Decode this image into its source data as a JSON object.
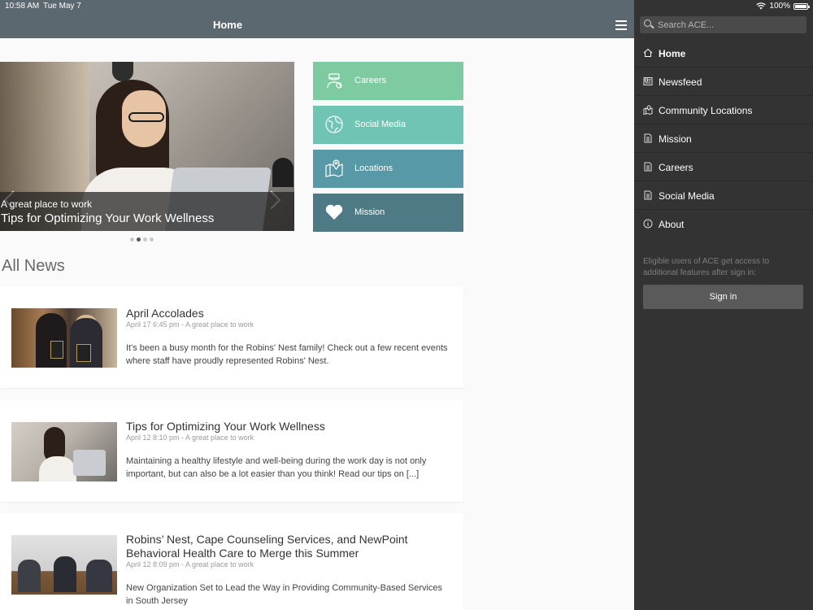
{
  "status": {
    "time": "10:58 AM",
    "date": "Tue May 7",
    "battery": "100%"
  },
  "header": {
    "title": "Home"
  },
  "carousel": {
    "category": "A great place to work",
    "headline": "Tips for Optimizing Your Work Wellness",
    "active_slide": 2,
    "slide_count": 4
  },
  "tiles": [
    {
      "label": "Careers",
      "icon": "careers-icon",
      "color": "#7ecba2"
    },
    {
      "label": "Social Media",
      "icon": "globe-icon",
      "color": "#6fc4b4"
    },
    {
      "label": "Locations",
      "icon": "map-pin-icon",
      "color": "#5799a6"
    },
    {
      "label": "Mission",
      "icon": "heart-icon",
      "color": "#4e7a86"
    }
  ],
  "news": {
    "heading": "All News",
    "items": [
      {
        "title": "April Accolades",
        "meta": "April 17 6:45 pm - A great place to work",
        "excerpt": "It's been a busy month for the Robins' Nest family! Check out a few recent events where staff have proudly represented Robins' Nest."
      },
      {
        "title": "Tips for Optimizing Your Work Wellness",
        "meta": "April 12 8:10 pm - A great place to work",
        "excerpt": "Maintaining a healthy lifestyle and well-being during the work day is not only important, but can also be a lot easier than you think! Read our tips on [...]"
      },
      {
        "title": "Robins’ Nest, Cape Counseling Services, and NewPoint Behavioral Health Care to Merge this Summer",
        "meta": "April 12 8:09 pm - A great place to work",
        "excerpt": "New Organization Set to Lead the Way in Providing Community-Based Services in South Jersey"
      }
    ]
  },
  "drawer": {
    "search_placeholder": "Search ACE...",
    "menu": [
      {
        "label": "Home",
        "icon": "home-icon",
        "active": true
      },
      {
        "label": "Newsfeed",
        "icon": "newsfeed-icon"
      },
      {
        "label": "Community Locations",
        "icon": "map-icon"
      },
      {
        "label": "Mission",
        "icon": "document-icon"
      },
      {
        "label": "Careers",
        "icon": "document-icon"
      },
      {
        "label": "Social Media",
        "icon": "document-icon"
      },
      {
        "label": "About",
        "icon": "info-icon"
      }
    ],
    "note": "Eligible users of ACE get access to additional features after sign in:",
    "signin_label": "Sign in"
  },
  "colors": {
    "header_bg": "#5c6870",
    "drawer_bg": "#333333"
  }
}
